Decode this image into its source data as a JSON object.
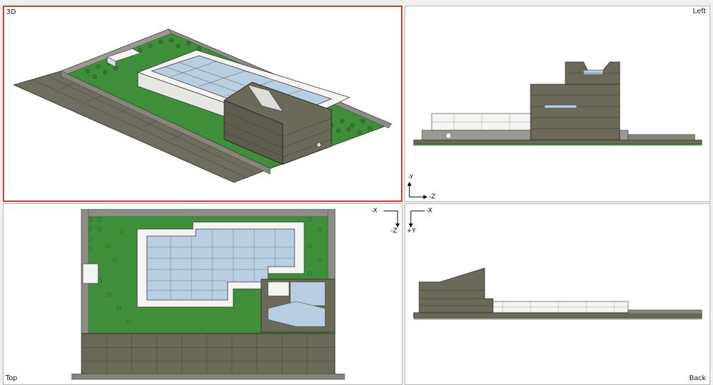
{
  "viewports": {
    "three_d": {
      "label": "3D"
    },
    "left": {
      "label": "Left"
    },
    "top": {
      "label": "Top"
    },
    "back": {
      "label": "Back"
    }
  },
  "axes": {
    "left_view": {
      "up": "-Y",
      "right": "-Z"
    },
    "top_view": {
      "right": "-X",
      "down": "-Z"
    },
    "back_view": {
      "right": "-X",
      "down": "+Y"
    }
  },
  "colors": {
    "active_border": "#d03a3a",
    "grass_green": "#3f8f3a",
    "stone_gray": "#6b6a58",
    "light_gray": "#9a9a92",
    "white_brick": "#f4f4f2",
    "glass_blue": "#b7cfe0"
  }
}
